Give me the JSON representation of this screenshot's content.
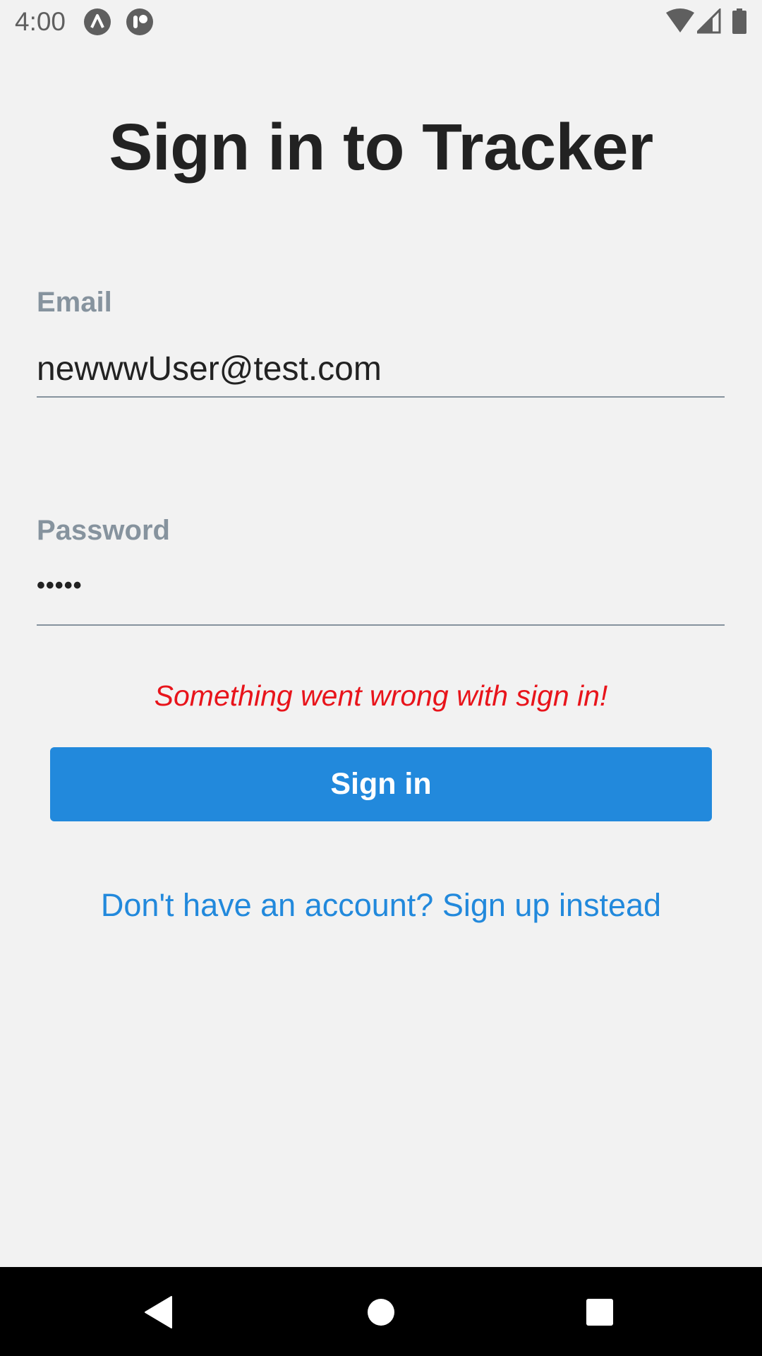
{
  "status_bar": {
    "time": "4:00"
  },
  "screen": {
    "title": "Sign in to Tracker"
  },
  "form": {
    "email_label": "Email",
    "email_value": "newwwUser@test.com",
    "password_label": "Password",
    "password_masked": "•••••",
    "error_message": "Something went wrong with sign in!",
    "signin_label": "Sign in",
    "signup_link": "Don't have an account? Sign up instead"
  },
  "colors": {
    "accent": "#2289dc",
    "error": "#e8141b",
    "label": "#86939e",
    "title": "#222222",
    "background": "#f2f2f2"
  },
  "icons": {
    "status_left": [
      "notification-app-icon",
      "notification-react-icon"
    ],
    "status_right": [
      "wifi-icon",
      "cell-signal-icon",
      "battery-icon"
    ],
    "nav": [
      "back-icon",
      "home-icon",
      "recents-icon"
    ]
  }
}
